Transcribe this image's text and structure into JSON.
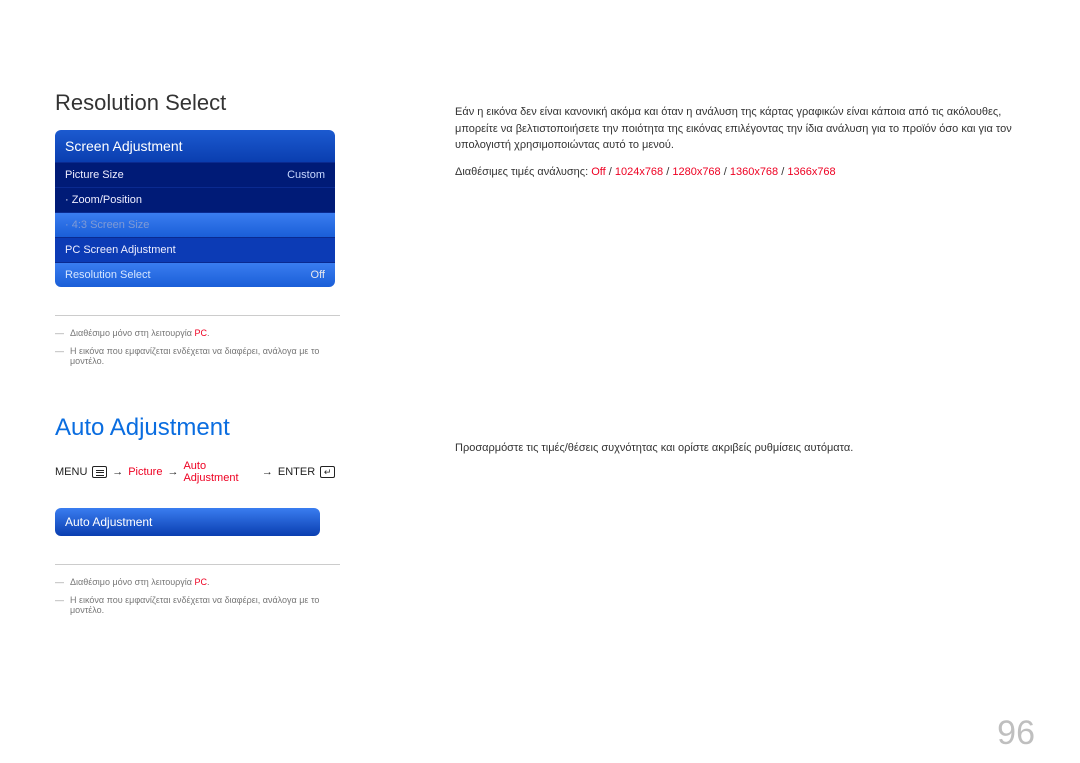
{
  "page_number": "96",
  "section1": {
    "title": "Resolution Select",
    "menu_header": "Screen Adjustment",
    "items": [
      {
        "label": "Picture Size",
        "value": "Custom"
      },
      {
        "label": "· Zoom/Position",
        "value": ""
      },
      {
        "label": "· 4:3 Screen Size",
        "value": ""
      },
      {
        "label": "PC Screen Adjustment",
        "value": ""
      },
      {
        "label": "Resolution Select",
        "value": "Off"
      }
    ],
    "footnote1_pre": "Διαθέσιμο μόνο στη λειτουργία ",
    "footnote1_pc": "PC",
    "footnote1_post": ".",
    "footnote2": "Η εικόνα που εμφανίζεται ενδέχεται να διαφέρει, ανάλογα με το μοντέλο.",
    "body": "Εάν η εικόνα δεν είναι κανονική ακόμα και όταν η ανάλυση της κάρτας γραφικών είναι κάποια από τις ακόλουθες, μπορείτε να βελτιστοποιήσετε την ποιότητα της εικόνας επιλέγοντας την ίδια ανάλυση για το προϊόν όσο και για τον υπολογιστή χρησιμοποιώντας αυτό το μενού.",
    "res_label": "Διαθέσιμες τιμές ανάλυσης: ",
    "res_opts": [
      "Off",
      "1024x768",
      "1280x768",
      "1360x768",
      "1366x768"
    ]
  },
  "section2": {
    "title": "Auto Adjustment",
    "body": "Προσαρμόστε τις τιμές/θέσεις συχνότητας και ορίστε ακριβείς ρυθμίσεις αυτόματα.",
    "path": {
      "menu": "MENU",
      "p1": "Picture",
      "p2": "Auto Adjustment",
      "enter": "ENTER"
    },
    "bar": "Auto Adjustment",
    "footnote1_pre": "Διαθέσιμο μόνο στη λειτουργία ",
    "footnote1_pc": "PC",
    "footnote1_post": ".",
    "footnote2": "Η εικόνα που εμφανίζεται ενδέχεται να διαφέρει, ανάλογα με το μοντέλο."
  }
}
